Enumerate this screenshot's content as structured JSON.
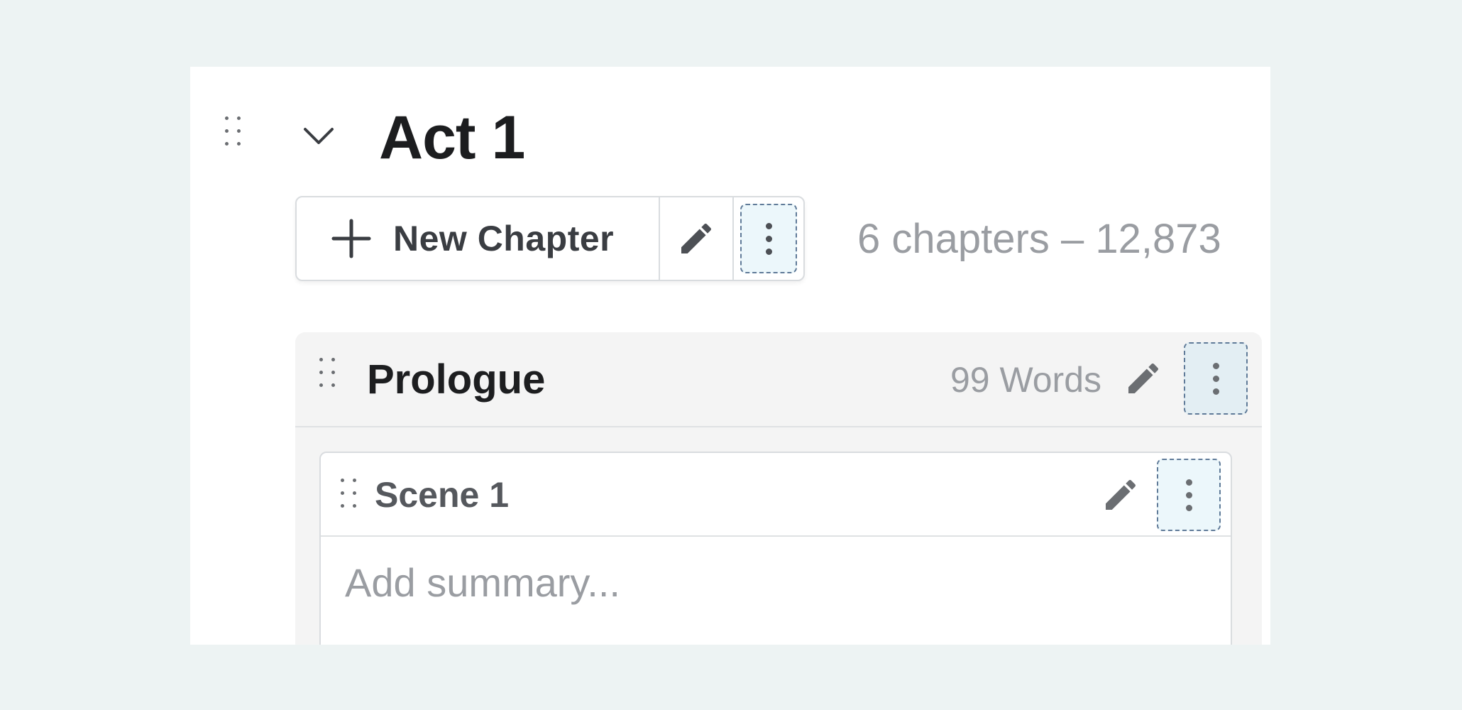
{
  "act": {
    "title": "Act 1",
    "new_chapter_label": "New Chapter",
    "stats": "6 chapters – 12,873"
  },
  "chapter": {
    "title": "Prologue",
    "word_count": "99 Words"
  },
  "scene": {
    "title": "Scene 1",
    "summary_placeholder": "Add summary..."
  },
  "icons": {
    "drag": "drag-handle-icon",
    "collapse": "chevron-down-icon",
    "add": "plus-icon",
    "edit": "pencil-icon",
    "more": "kebab-menu-icon"
  },
  "colors": {
    "background": "#edf3f3",
    "panel": "#ffffff",
    "chapter_bg": "#f4f4f4",
    "focus_outline": "#5f7a98",
    "focus_fill": "#ecf7fb",
    "muted_text": "#9a9da2"
  }
}
